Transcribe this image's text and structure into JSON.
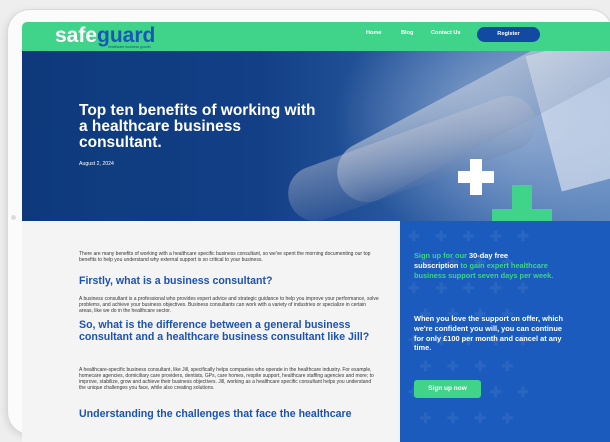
{
  "nav": {
    "logo_safe": "safe",
    "logo_guard": "guard",
    "logo_tagline": "healthcare business growth",
    "links": {
      "home": "Home",
      "blog": "Blog",
      "contact": "Contact Us"
    },
    "register": "Register"
  },
  "hero": {
    "title": "Top ten benefits of working with a healthcare business consultant.",
    "date": "August 2, 2024"
  },
  "article": {
    "intro": "There are many benefits of working with a healthcare specific business consultant, so we've spent the morning documenting our top benefits to help you understand why external support is so critical to your business.",
    "h1": "Firstly, what is a business consultant?",
    "p1": "A business consultant is a professional who provides expert advice and strategic guidance to help you improve your performance, solve problems, and achieve your business objectives. Business consultants can work with a variety of industries or specialize in certain areas, like we do in the healthcare sector.",
    "h2": "So, what is the difference between a general business consultant and a healthcare business consultant like Jill?",
    "p2": "A healthcare-specific business consultant, like Jill, specifically helps companies who operate in the healthcare industry. For example, homecare agencies, domiciliary care providers, dentists, GPs, care homes, respite support, healthcare staffing agencies and more; to improve, stabilize, grow and achieve their business objectives. Jill, working as a healthcare specific consultant helps you understand the unique challenges you face, while also creating solutions.",
    "h3": "Understanding the challenges that face the healthcare"
  },
  "side": {
    "promo_part1": "Sign up for our ",
    "promo_part2": "30-day free subscription",
    "promo_part3": " to gain expert healthcare business support seven days per week.",
    "promo_secondary": "When you love the support on offer, which we're confident you will, you can continue for only £100 per month and cancel at any time.",
    "signup_button": "Sign up now"
  },
  "colors": {
    "brand_green": "#3fd48a",
    "brand_blue": "#1a5bbd",
    "heading_blue": "#1c52b2",
    "register_blue": "#114aa0"
  }
}
